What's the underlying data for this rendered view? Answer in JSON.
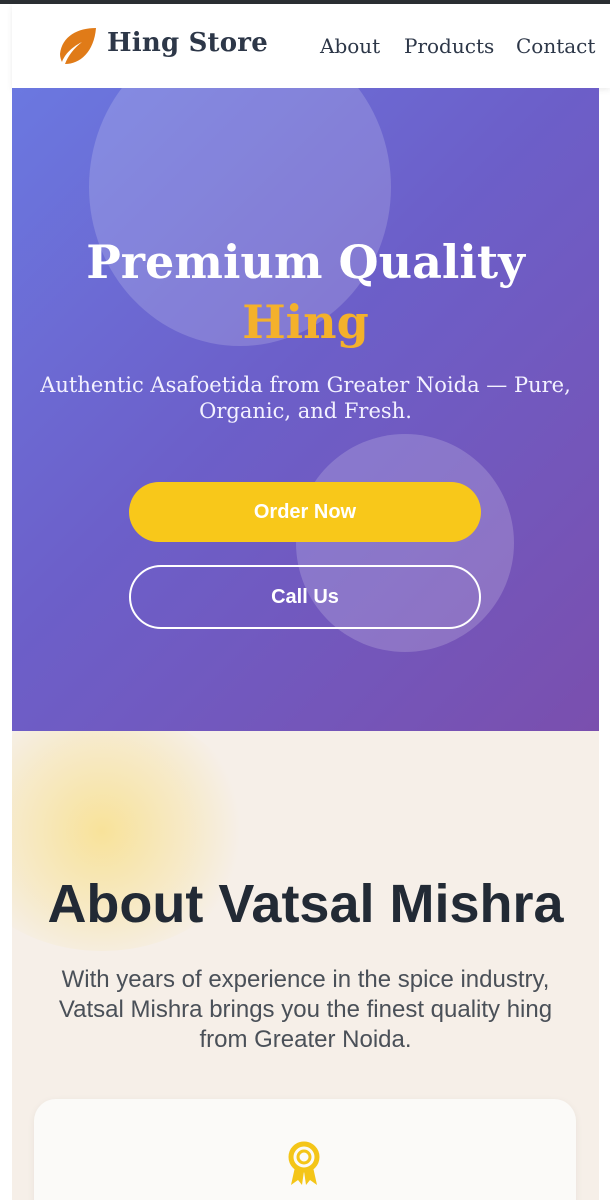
{
  "header": {
    "brand": "Hing Store",
    "logo_icon": "leaf-icon",
    "nav": [
      "About",
      "Products",
      "Contact"
    ]
  },
  "hero": {
    "title": "Premium Quality",
    "accent": "Hing",
    "subtitle": "Authentic Asafoetida from Greater Noida — Pure, Organic, and Fresh.",
    "primary_button": "Order Now",
    "secondary_button": "Call Us"
  },
  "about": {
    "title": "About Vatsal Mishra",
    "text": "With years of experience in the spice industry, Vatsal Mishra brings you the finest quality hing from Greater Noida.",
    "card_icon": "award-icon"
  },
  "colors": {
    "accent": "#f4b12b",
    "button": "#f8c81a",
    "hero_start": "#6b78e0",
    "hero_end": "#7a4fae",
    "text_dark": "#222a35"
  }
}
